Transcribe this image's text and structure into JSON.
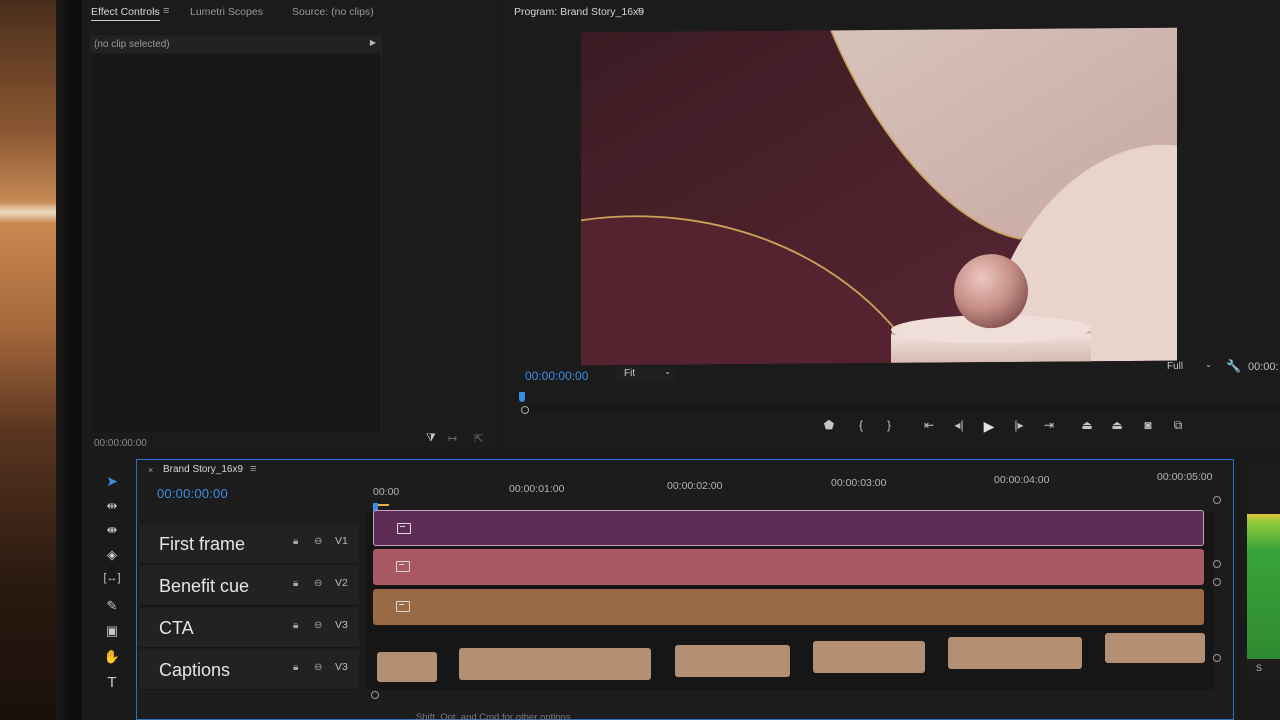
{
  "effect_controls": {
    "tabs": [
      "Effect Controls",
      "Lumetri Scopes",
      "Source: (no clips)"
    ],
    "hamburger": "≡",
    "clip_label": "(no clip selected)",
    "timecode": "00:00:00:00"
  },
  "program": {
    "title": "Program: Brand Story_16x9",
    "timecode": "00:00:00:00",
    "fit": "Fit",
    "full": "Full",
    "right_timecode": "00:00:",
    "transport": [
      "marker-icon",
      "mark-in-icon",
      "mark-out-icon",
      "go-to-in-icon",
      "step-back-icon",
      "play-icon",
      "step-forward-icon",
      "go-to-out-icon",
      "lift-icon",
      "extract-icon",
      "camera-icon",
      "compare-icon"
    ]
  },
  "timeline": {
    "sequence": "Brand Story_16x9",
    "timecode": "00:00:00:00",
    "ruler": [
      "00:00",
      "00:00:01:00",
      "00:00:02:00",
      "00:00:03:00",
      "00:00:04:00",
      "00:00:05:00"
    ],
    "tracks": [
      {
        "name": "First frame",
        "id": "V1",
        "color": "#5e2d55"
      },
      {
        "name": "Benefit cue",
        "id": "V2",
        "color": "#a95864"
      },
      {
        "name": "CTA",
        "id": "V3",
        "color": "#9a6a45"
      },
      {
        "name": "Captions",
        "id": "V3",
        "color": "#b38f73"
      }
    ]
  },
  "tools": [
    "selection-tool-icon",
    "track-select-icon",
    "ripple-edit-icon",
    "razor-icon",
    "slip-icon",
    "pen-icon",
    "rectangle-icon",
    "hand-icon",
    "type-icon"
  ],
  "audio_meter": {
    "label": "S"
  },
  "hint": "...Shift, Opt, and Cmd for other options"
}
